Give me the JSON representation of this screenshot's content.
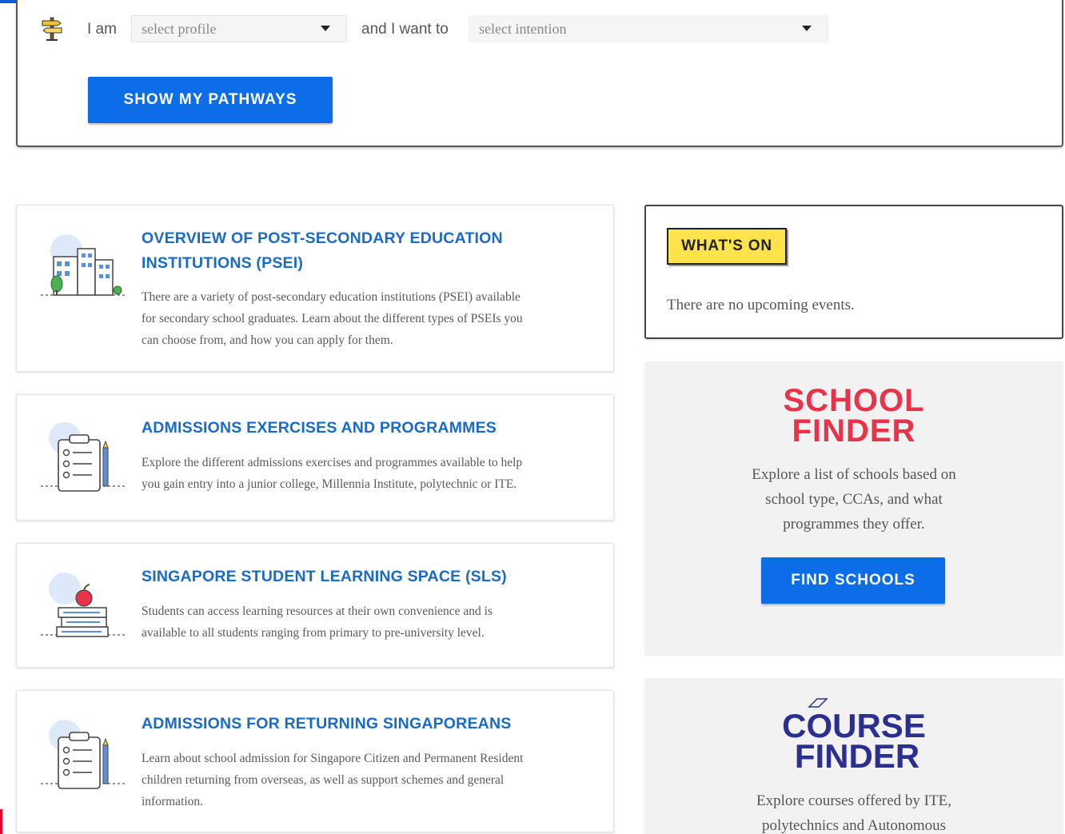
{
  "pathway": {
    "i_am_label": "I am",
    "profile_placeholder": "select profile",
    "want_label": "and I want to",
    "intention_placeholder": "select intention",
    "button_label": "SHOW MY PATHWAYS"
  },
  "cards": [
    {
      "title_line1": "OVERVIEW OF POST-SECONDARY EDUCATION",
      "title_line2": "INSTITUTIONS (PSEI)",
      "desc_lines": [
        "There are a variety of post-secondary education institutions (PSEI) available",
        "for secondary school graduates. Learn about the different types of PSEIs you",
        "can choose from, and how you can apply for them."
      ],
      "icon": "buildings-icon"
    },
    {
      "title_line1": "ADMISSIONS EXERCISES AND PROGRAMMES",
      "desc_lines": [
        "Explore the different admissions exercises and programmes available to help",
        "you gain entry into a junior college, Millennia Institute, polytechnic or ITE."
      ],
      "icon": "clipboard-icon"
    },
    {
      "title_line1": "SINGAPORE STUDENT LEARNING SPACE (SLS)",
      "desc_lines": [
        "Students can access learning resources at their own convenience and is",
        "available to all students ranging from primary to pre-university level."
      ],
      "icon": "books-apple-icon"
    },
    {
      "title_line1": "ADMISSIONS FOR RETURNING SINGAPOREANS",
      "desc_lines": [
        "Learn about school admission for Singapore Citizen and Permanent Resident",
        "children returning from overseas, as well as support schemes and general",
        "information."
      ],
      "icon": "clipboard-icon"
    }
  ],
  "whats_on": {
    "badge": "WHAT'S ON",
    "empty_text": "There are no upcoming events."
  },
  "school_finder": {
    "logo_line1": "SCHOOL",
    "logo_line2": "FINDER",
    "desc_lines": [
      "Explore a list of schools based on",
      "school type, CCAs, and what",
      "programmes they offer."
    ],
    "button_label": "FIND SCHOOLS",
    "color": "#e8334a"
  },
  "course_finder": {
    "logo_line1": "COURSE",
    "logo_line2": "FINDER",
    "desc_lines": [
      "Explore courses offered by ITE,",
      "polytechnics and Autonomous"
    ],
    "color": "#2b2f8f"
  },
  "colors": {
    "primary_button": "#0c6de8",
    "card_title": "#1a6bc4",
    "whats_on_badge": "#ffe34d"
  }
}
